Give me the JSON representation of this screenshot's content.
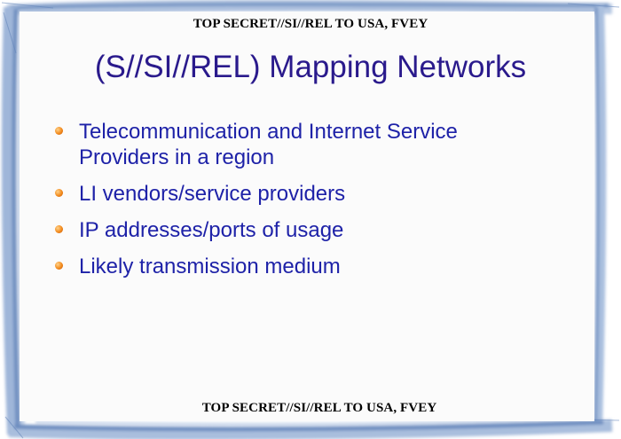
{
  "slide": {
    "classification_top": "TOP SECRET//SI//REL TO USA, FVEY",
    "classification_bottom": "TOP SECRET//SI//REL TO USA, FVEY",
    "title": "(S//SI//REL) Mapping Networks",
    "bullets": [
      {
        "line1": "Telecommunication and Internet Service",
        "line2": "Providers in a region"
      },
      {
        "line1": "LI vendors/service providers"
      },
      {
        "line1": "IP addresses/ports of usage"
      },
      {
        "line1": "Likely transmission medium"
      }
    ]
  },
  "colors": {
    "title": "#2a1a8c",
    "bullet_text": "#1e22a8",
    "bullet_marker": "#f28a1c",
    "frame": "#8fa9cf"
  }
}
